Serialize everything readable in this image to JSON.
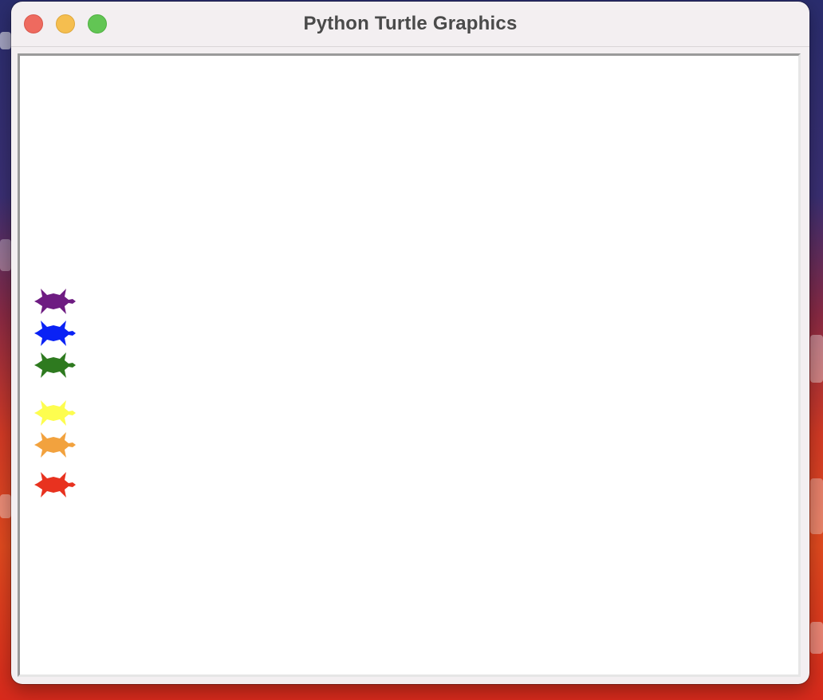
{
  "window": {
    "title": "Python Turtle Graphics"
  },
  "controls": {
    "close": "close",
    "minimize": "minimize",
    "zoom": "zoom"
  },
  "turtles": [
    {
      "name": "purple",
      "color": "#6e1c82"
    },
    {
      "name": "blue",
      "color": "#0a22f5"
    },
    {
      "name": "green",
      "color": "#2e7a1f"
    },
    {
      "name": "yellow",
      "color": "#fdfd4f"
    },
    {
      "name": "orange",
      "color": "#f2a23e"
    },
    {
      "name": "red",
      "color": "#e8321f"
    }
  ],
  "colors": {
    "close": "#ee6a5f",
    "minimize": "#f5be4f",
    "zoom": "#62c554"
  }
}
